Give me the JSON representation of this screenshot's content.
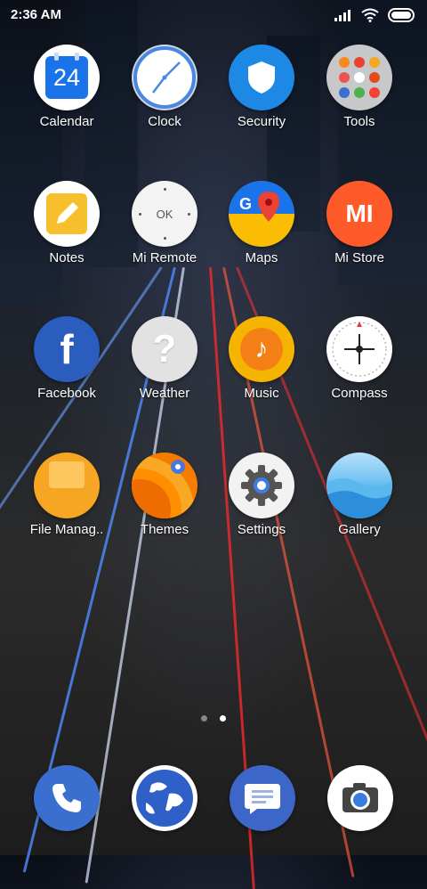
{
  "status_bar": {
    "time": "2:36 AM",
    "icons": [
      "signal-icon",
      "wifi-icon",
      "battery-icon"
    ]
  },
  "apps": [
    {
      "label": "Calendar",
      "icon": "calendar-icon",
      "text": "24"
    },
    {
      "label": "Clock",
      "icon": "clock-icon"
    },
    {
      "label": "Security",
      "icon": "shield-icon"
    },
    {
      "label": "Tools",
      "icon": "folder-icon"
    },
    {
      "label": "Notes",
      "icon": "notes-icon"
    },
    {
      "label": "Mi Remote",
      "icon": "remote-icon",
      "text": "OK"
    },
    {
      "label": "Maps",
      "icon": "maps-icon",
      "text": "G"
    },
    {
      "label": "Mi Store",
      "icon": "mi-store-icon",
      "text": "MI"
    },
    {
      "label": "Facebook",
      "icon": "facebook-icon",
      "text": "f"
    },
    {
      "label": "Weather",
      "icon": "weather-icon",
      "text": "?"
    },
    {
      "label": "Music",
      "icon": "music-icon",
      "text": "♪"
    },
    {
      "label": "Compass",
      "icon": "compass-icon"
    },
    {
      "label": "File Manag..",
      "icon": "folder-icon"
    },
    {
      "label": "Themes",
      "icon": "themes-icon"
    },
    {
      "label": "Settings",
      "icon": "gear-icon"
    },
    {
      "label": "Gallery",
      "icon": "gallery-icon"
    }
  ],
  "page_indicator": {
    "pages": 2,
    "current": 2
  },
  "dock": [
    {
      "name": "phone",
      "icon": "phone-icon"
    },
    {
      "name": "browser",
      "icon": "globe-icon"
    },
    {
      "name": "messages",
      "icon": "message-icon"
    },
    {
      "name": "camera",
      "icon": "camera-icon"
    }
  ],
  "colors": {
    "calendar": "#1a73e8",
    "clock": "#4b87e0",
    "security": "#1e88e5",
    "notes": "#f6c02c",
    "mi_store": "#ff5b2a",
    "facebook": "#2a5dbd",
    "music": "#f5b400",
    "file_manager": "#f6a623",
    "settings": "#f2f2f2",
    "gallery": "#3aa3e8",
    "phone": "#3a6fd0",
    "browser": "#2f60c7",
    "messages": "#3c66c8"
  }
}
